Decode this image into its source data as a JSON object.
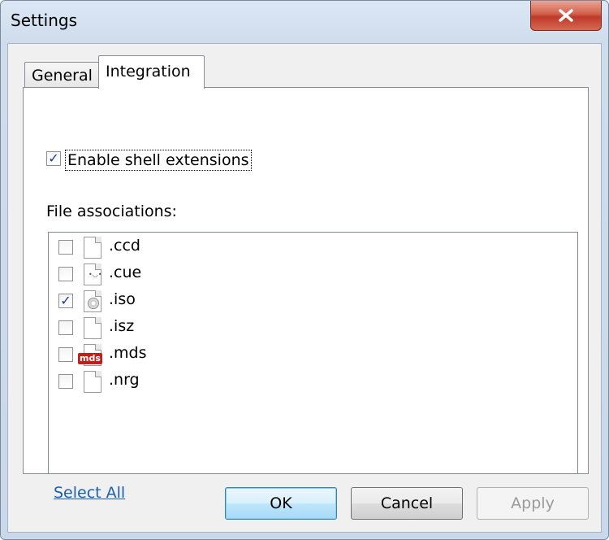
{
  "window": {
    "title": "Settings"
  },
  "tabs": [
    {
      "label": "General"
    },
    {
      "label": "Integration"
    }
  ],
  "integration": {
    "shell_extensions_label": "Enable shell extensions",
    "shell_extensions_checked": true,
    "file_associations_label": "File associations:",
    "associations": [
      {
        "ext": ".ccd",
        "checked": false,
        "icon": "blank-file-icon"
      },
      {
        "ext": ".cue",
        "checked": false,
        "icon": "cue-file-icon"
      },
      {
        "ext": ".iso",
        "checked": true,
        "icon": "disc-image-icon"
      },
      {
        "ext": ".isz",
        "checked": false,
        "icon": "blank-file-icon"
      },
      {
        "ext": ".mds",
        "checked": false,
        "icon": "mds-file-icon"
      },
      {
        "ext": ".nrg",
        "checked": false,
        "icon": "blank-file-icon"
      }
    ],
    "select_all_label": "Select All",
    "mds_badge": "mds"
  },
  "buttons": {
    "ok": "OK",
    "cancel": "Cancel",
    "apply": "Apply"
  },
  "colors": {
    "close_button": "#c0392b",
    "link": "#1a5fb4"
  }
}
